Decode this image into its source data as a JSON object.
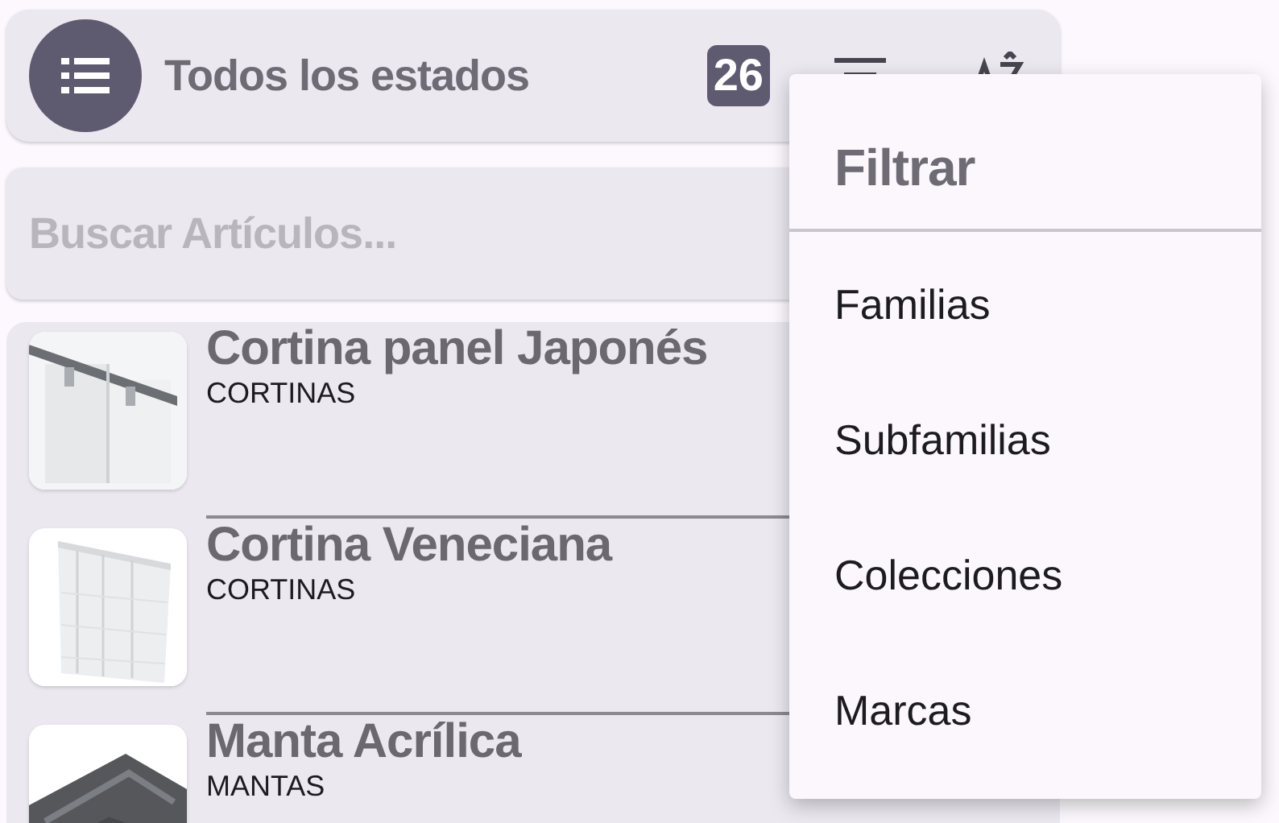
{
  "header": {
    "title": "Todos los estados",
    "count": "26"
  },
  "search": {
    "placeholder": "Buscar Artículos..."
  },
  "items": [
    {
      "title": "Cortina panel Japonés",
      "category": "CORTINAS"
    },
    {
      "title": "Cortina Veneciana",
      "category": "CORTINAS"
    },
    {
      "title": "Manta Acrílica",
      "category": "MANTAS"
    }
  ],
  "menu": {
    "title": "Filtrar",
    "items": [
      {
        "label": "Familias"
      },
      {
        "label": "Subfamilias"
      },
      {
        "label": "Colecciones"
      },
      {
        "label": "Marcas"
      }
    ]
  }
}
